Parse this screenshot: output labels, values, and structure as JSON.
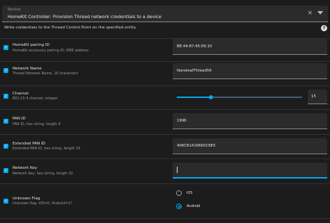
{
  "service": {
    "label": "Service",
    "value": "HomeKit Controller: Provision Thread network credentials to a device",
    "clear_glyph": "×"
  },
  "description": "Write credentials to the Thread Control Point on the specified entity.",
  "help_glyph": "?",
  "check_glyph": "✓",
  "fields": [
    {
      "title": "HomeKit pairing ID",
      "desc": "HomeKit accessory pairing ID, IEEE address",
      "value": "BE:44:87:45:E6:10"
    },
    {
      "title": "Network Name",
      "desc": "Thread Network Name, 16 characters",
      "value": "NanoleafThread56"
    },
    {
      "title": "Channel",
      "desc": "802.15.4 channel, integer",
      "value": "15",
      "slider_fraction": 0.27
    },
    {
      "title": "PAN ID",
      "desc": "PAN ID, hex string, length 4",
      "value": "1996"
    },
    {
      "title": "Extended PAN ID",
      "desc": "Extended PAN ID, hex string, length 16",
      "value": "406C81416665C6E5"
    },
    {
      "title": "Network Key",
      "desc": "Network Key, hex string, length 32",
      "value": ""
    },
    {
      "title": "Unknown Flag",
      "desc": "Unknown flag, iOS=0, Android=1?",
      "options": [
        "iOS",
        "Android"
      ],
      "selected": "Android"
    }
  ],
  "colors": {
    "accent": "#03a9f4",
    "background": "#1c1c1c",
    "field": "#2b2b2b"
  }
}
